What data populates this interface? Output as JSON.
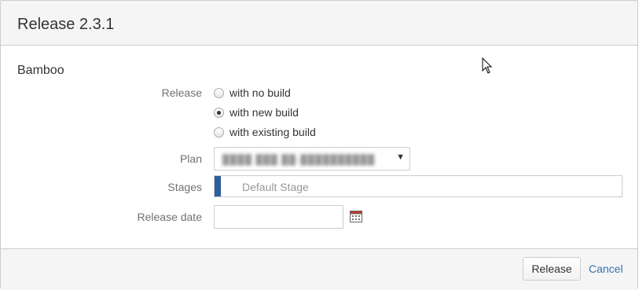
{
  "dialog": {
    "title": "Release 2.3.1"
  },
  "section": {
    "title": "Bamboo"
  },
  "form": {
    "release_label": "Release",
    "release_options": [
      {
        "label": "with no build",
        "checked": false
      },
      {
        "label": "with new build",
        "checked": true
      },
      {
        "label": "with existing build",
        "checked": false
      }
    ],
    "plan_label": "Plan",
    "plan_value": "████ ███ ██-██████████",
    "stages_label": "Stages",
    "stages_value": "Default Stage",
    "release_date_label": "Release date",
    "release_date_value": ""
  },
  "footer": {
    "release_button": "Release",
    "cancel_link": "Cancel"
  },
  "icons": {
    "calendar": "calendar-icon",
    "dropdown": "chevron-down-icon",
    "cursor": "mouse-pointer-icon"
  },
  "colors": {
    "header_bg": "#f5f5f5",
    "stage_accent": "#2b5f9e",
    "link": "#3572b0"
  }
}
